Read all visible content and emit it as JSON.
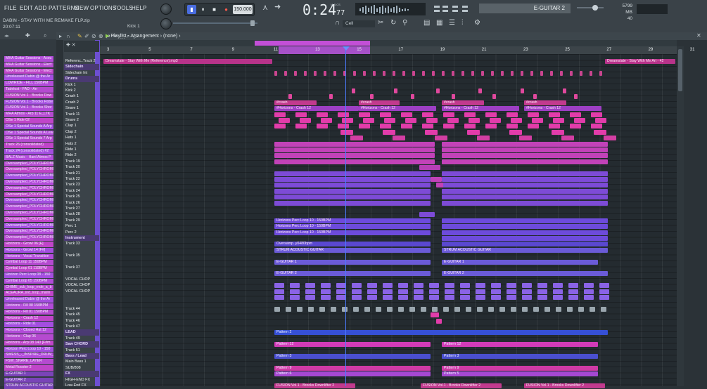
{
  "menu": [
    "FILE",
    "EDIT",
    "ADD",
    "PATTERNS",
    "VIEW",
    "OPTIONS",
    "TOOLS",
    "HELP"
  ],
  "project": {
    "name": "DABIN - STAY WITH ME REMAKE FLP.zip",
    "time": "20:07:11"
  },
  "hint": "Kick 1",
  "transport": {
    "tempo": "150.000",
    "time_main": "0:24",
    "time_sub": "77",
    "time_label": "M:S:CS"
  },
  "channel_name": "E-GUITAR 2",
  "memory": {
    "mb": "5799 MB",
    "cpu": "40"
  },
  "snap": "Cell",
  "playlist": {
    "title": "Playlist - Arrangement",
    "pattern": "(none)"
  },
  "ruler_numbers": [
    "3",
    "5",
    "7",
    "9",
    "11",
    "13",
    "15",
    "17",
    "19",
    "21",
    "23",
    "25",
    "27",
    "29",
    "31",
    "33"
  ],
  "browser_items": [
    "MHA Guitar Sessions - Acou",
    "MHA Guitar Sessions - Elect",
    "MHA Guitar Sessions - Elect",
    "Unreleased Dabin @ the Ar",
    "LOWRIDE - FILL 150BPM",
    "Tadelost - FAD - Arr",
    "FUSION Vol.1 - Brooks Dow",
    "FUSION Vol.1 - Brooks Robe",
    "FUSION Vol.1 - Brooks Shor",
    "MHA Atmos - Arp 11 E_LTK",
    "OSe 1 Ride 02",
    "OSe 1 Special Sounds A Arp",
    "OSe 1 Special Sounds A Lead",
    "OSe 1 Special Sounds 7 Arp",
    "Track 26 (consolidated)",
    "Track 24 (consolidated) #2",
    "BALZ Music - Hard Atmos P",
    "Oversampled_POLYCHROME",
    "Oversampled_POLYCHROME",
    "Oversampled_POLYCHROME",
    "Oversampled_POLYCHROME",
    "Oversampled_POLYCHROME",
    "Oversampled_POLYCHROME",
    "Oversampled_POLYCHROME",
    "Oversampled_POLYCHROME",
    "Oversampled_POLYCHROME",
    "Oversampled_POLYCHROME",
    "Oversampled_POLYCHROME",
    "Oversampled_POLYCHROME",
    "Oversampled_POLYCHROME",
    "Horizons - Growl 06 [E]",
    "Horizons - Growl 14 [F#]",
    "Horizons - Vocal Transition",
    "Cymbal Loop 11 150BPM",
    "Cymbal Loop 01 110BPM",
    "Horizon Perc Loop 08 - 150",
    "Cymbal Loop 05 150BPM",
    "CHIME_sub_loop_rnde_a_b",
    "ACEAURA_ind_loop_marin",
    "Unreleased Dabin @ the Ar",
    "Horizons - Fill 08 150BPM",
    "Horizons - Fill 01 150BPM",
    "Horizons - Crash 12",
    "Horizons - Ride 01",
    "Horizons - Closed Hat 12",
    "Horizons - Clap 06",
    "Horizons - Arp 08 140 [F#m",
    "Horizon Perc Loop 10 - 150",
    "SWESS_-_INSPIRE_DRUM_FI",
    "FSW_SNARE_LAYER",
    "Metal Rooster 2",
    "E-GUITAR 1",
    "E-GUITAR 2",
    "STRUM ACOUSTIC GUITAR"
  ],
  "tracks": [
    "Referenc..Track 2",
    "Sidechain",
    "Sidechain Int",
    "Drums",
    "Kick 1",
    "Kick 2",
    "Crash 1",
    "Crash 2",
    "Snare 1",
    "Track 11",
    "Snare 2",
    "Clap 1",
    "Clap 2",
    "Hats 1",
    "Hats 2",
    "Ride 1",
    "Ride 2",
    "Track 19",
    "Track 20",
    "Track 21",
    "Track 22",
    "Track 23",
    "Track 24",
    "Track 25",
    "Track 26",
    "Track 27",
    "Track 28",
    "Track 29",
    "Perc 1",
    "Perc 2",
    "Instrument",
    "Track 33",
    "",
    "Track 35",
    "",
    "Track 37",
    "",
    "VOCAL CHOP",
    "VOCAL CHOP",
    "VOCAL CHOP",
    "",
    "",
    "Track 44",
    "Track 45",
    "Track 46",
    "Track 47",
    "LEAD",
    "Track 49",
    "Saw CHORD",
    "Track 51",
    "Bass / Lead",
    "Main Bass 1",
    "SUB/808",
    "FX",
    "HIGH-END FX",
    "Low-End FX"
  ],
  "clip_labels": {
    "reference": "Dreamstate - Stay With Me (Reference).mp3",
    "reference_end": "Dreamstate - Stay With Me Art - 42",
    "crash": "#crash",
    "horizons_crash": "#Horizons - Crash 12",
    "guitar": "STRUM ACOUSTIC GUITAR",
    "e1": "E-GUITAR 1",
    "e2": "E-GUITAR 2",
    "pattern2": "Pattern 2",
    "pattern12": "Pattern 12",
    "pattern3": "Pattern 3",
    "pattern9": "Pattern 9",
    "pattern6": "Pattern 6",
    "pattern5": "Pattern 5",
    "fusion": "FUSION Vol.1 - Brooks Downlifter 2",
    "horizons_perc": "Horizons Perc Loop 10 - 150BPM",
    "oversampled": "Oversamp..y0480bpm"
  },
  "colors": {
    "magenta": "#c23a8e",
    "violet": "#6b5bd8",
    "blue": "#3650d6",
    "pink": "#e23caa"
  }
}
